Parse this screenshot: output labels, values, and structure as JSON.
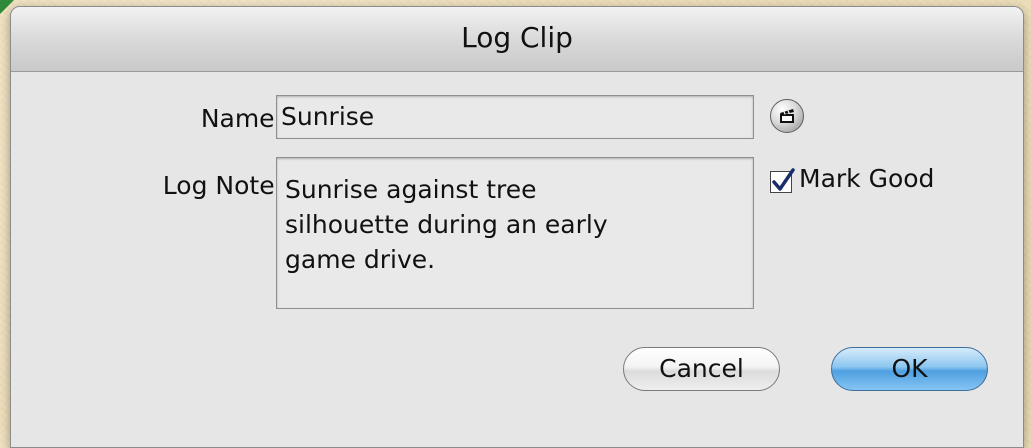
{
  "dialog": {
    "title": "Log Clip",
    "name_label": "Name:",
    "name_value": "Sunrise",
    "log_note_label": "Log Note:",
    "log_note_value": "Sunrise against tree\nsilhouette during an early\ngame drive.",
    "mark_good_label": "Mark Good",
    "mark_good_checked": true,
    "cancel_label": "Cancel",
    "ok_label": "OK",
    "clapper_icon": "clapperboard-icon"
  },
  "colors": {
    "background": "#efe0bd",
    "dialog": "#e6e6e6",
    "default_button": "#4fa0e1"
  }
}
